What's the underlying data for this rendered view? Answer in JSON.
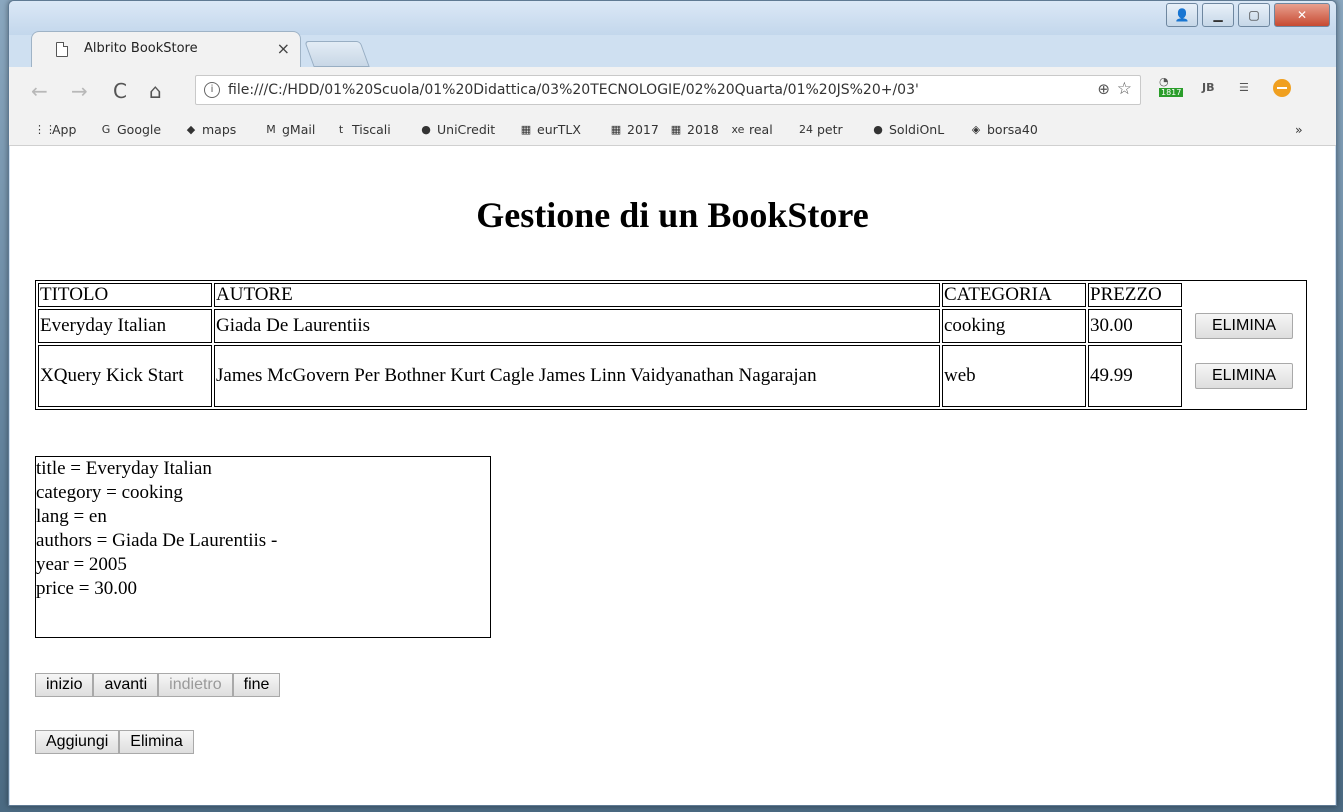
{
  "browser": {
    "tab_title": "Albrito BookStore",
    "tab_close": "×",
    "url": "file:///C:/HDD/01%20Scuola/01%20Didattica/03%20TECNOLOGIE/02%20Quarta/01%20JS%20+/03'",
    "extension_badge": "1817",
    "jb_label": "JB",
    "bookmarks": [
      {
        "icon": "apps-grid-icon",
        "glyph": "⋮⋮",
        "label": "App"
      },
      {
        "icon": "google-icon",
        "glyph": "G",
        "label": "Google"
      },
      {
        "icon": "maps-icon",
        "glyph": "◆",
        "label": "maps"
      },
      {
        "icon": "gmail-icon",
        "glyph": "M",
        "label": "gMail"
      },
      {
        "icon": "tiscali-icon",
        "glyph": "t",
        "label": "Tiscali"
      },
      {
        "icon": "unicredit-icon",
        "glyph": "●",
        "label": "UniCredit"
      },
      {
        "icon": "eurtlx-icon",
        "glyph": "▦",
        "label": "eurTLX"
      },
      {
        "icon": "grid-icon",
        "glyph": "▦",
        "label": "2017"
      },
      {
        "icon": "grid-icon",
        "glyph": "▦",
        "label": "2018"
      },
      {
        "icon": "xe-icon",
        "glyph": "xe",
        "label": "real"
      },
      {
        "icon": "sole24-icon",
        "glyph": "24",
        "label": "petr"
      },
      {
        "icon": "soldionline-icon",
        "glyph": "●",
        "label": "SoldiOnL"
      },
      {
        "icon": "borsa-icon",
        "glyph": "◈",
        "label": "borsa40"
      }
    ],
    "more_bookmarks": "»"
  },
  "page": {
    "heading": "Gestione di un BookStore",
    "table": {
      "headers": [
        "TITOLO",
        "AUTORE",
        "CATEGORIA",
        "PREZZO"
      ],
      "rows": [
        {
          "title": "Everyday Italian",
          "author": "Giada De Laurentiis",
          "category": "cooking",
          "price": "30.00",
          "action": "ELIMINA"
        },
        {
          "title": "XQuery Kick Start",
          "author": "James McGovern Per Bothner Kurt Cagle James Linn Vaidyanathan Nagarajan",
          "category": "web",
          "price": "49.99",
          "action": "ELIMINA"
        }
      ]
    },
    "detail": {
      "title": "title = Everyday Italian",
      "category": "category = cooking",
      "lang": "lang = en",
      "authors": "authors = Giada De Laurentiis -",
      "year": "year = 2005",
      "price": "price = 30.00"
    },
    "nav_buttons": {
      "start": "inizio",
      "next": "avanti",
      "prev": "indietro",
      "end": "fine"
    },
    "action_buttons": {
      "add": "Aggiungi",
      "delete": "Elimina"
    }
  }
}
